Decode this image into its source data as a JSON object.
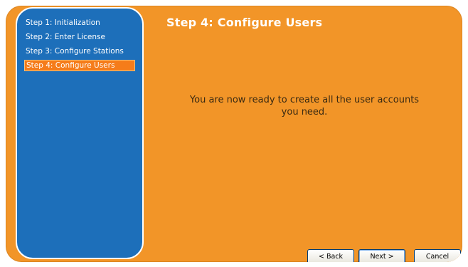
{
  "sidebar": {
    "steps": [
      {
        "label": "Step 1: Initialization",
        "active": false
      },
      {
        "label": "Step 2: Enter License",
        "active": false
      },
      {
        "label": "Step 3: Configure Stations",
        "active": false
      },
      {
        "label": "Step 4: Configure Users",
        "active": true
      }
    ]
  },
  "main": {
    "title": "Step 4: Configure Users",
    "message": "You are now ready to create all the user accounts you need."
  },
  "buttons": {
    "back": "< Back",
    "next": "Next >",
    "cancel": "Cancel"
  },
  "colors": {
    "background": "#f29528",
    "sidebar": "#1d6fba",
    "active_step": "#f57c1a"
  }
}
